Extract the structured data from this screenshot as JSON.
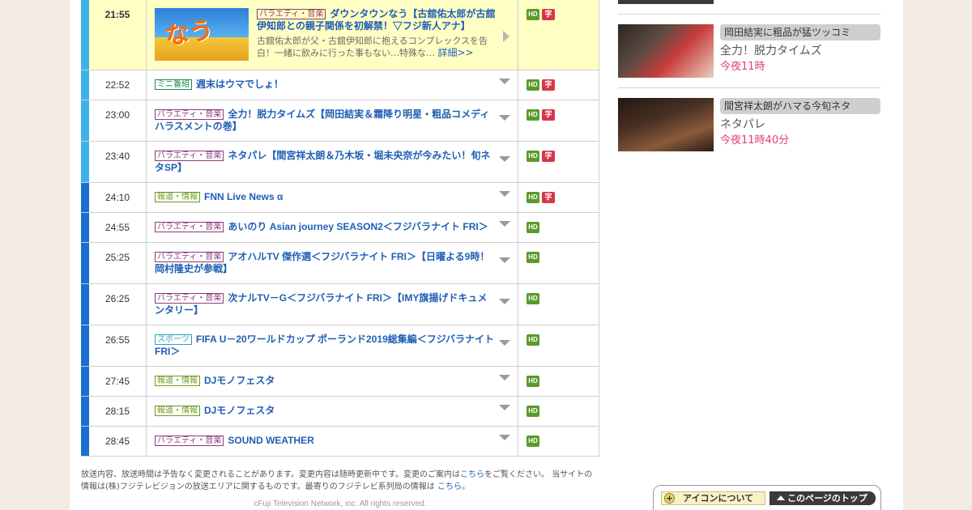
{
  "featured": {
    "time": "21:55",
    "genre": "バラエティ・音楽",
    "title": "ダウンタウンなう【古舘佑太郎が古舘伊知郎との親子関係を初解禁！▽フジ新人アナ】",
    "description": "古舘佑太郎が父・古舘伊知郎に抱えるコンプレックスを告白！一緒に飲みに行った事もない…特殊な…",
    "more_link": "詳細>>",
    "thumb_logo": "なう",
    "hd": "HD",
    "caption": "字"
  },
  "programs": [
    {
      "time": "22:52",
      "genre": "ミニ番組",
      "genre_type": "mini",
      "title": "週末はウマでしょ！",
      "hd": "HD",
      "caption": "字"
    },
    {
      "time": "23:00",
      "genre": "バラエティ・音楽",
      "genre_type": "var",
      "title": "全力！脱力タイムズ【岡田結実＆霜降り明星・粗品コメディハラスメントの巻】",
      "hd": "HD",
      "caption": "字"
    },
    {
      "time": "23:40",
      "genre": "バラエティ・音楽",
      "genre_type": "var",
      "title": "ネタパレ【間宮祥太朗＆乃木坂・堀未央奈が今みたい！旬ネタSP】",
      "hd": "HD",
      "caption": "字"
    },
    {
      "time": "24:10",
      "genre": "報道・情報",
      "genre_type": "news",
      "title": "FNN Live News α",
      "hd": "HD",
      "caption": "字"
    },
    {
      "time": "24:55",
      "genre": "バラエティ・音楽",
      "genre_type": "var",
      "title": "あいのり Asian journey SEASON2＜フジバラナイト FRI＞",
      "hd": "HD",
      "caption": ""
    },
    {
      "time": "25:25",
      "genre": "バラエティ・音楽",
      "genre_type": "var",
      "title": "アオハルTV 傑作選＜フジバラナイト FRI＞【日曜よる9時！岡村隆史が参戦】",
      "hd": "HD",
      "caption": ""
    },
    {
      "time": "26:25",
      "genre": "バラエティ・音楽",
      "genre_type": "var",
      "title": "次ナルTV－G＜フジバラナイト FRI＞【IMY旗揚げドキュメンタリー】",
      "hd": "HD",
      "caption": ""
    },
    {
      "time": "26:55",
      "genre": "スポーツ",
      "genre_type": "sport",
      "title": "FIFA U－20ワールドカップ ポーランド2019総集編＜フジバラナイト FRI＞",
      "hd": "HD",
      "caption": ""
    },
    {
      "time": "27:45",
      "genre": "報道・情報",
      "genre_type": "news",
      "title": "DJモノフェスタ",
      "hd": "HD",
      "caption": ""
    },
    {
      "time": "28:15",
      "genre": "報道・情報",
      "genre_type": "news",
      "title": "DJモノフェスタ",
      "hd": "HD",
      "caption": ""
    },
    {
      "time": "28:45",
      "genre": "バラエティ・音楽",
      "genre_type": "var",
      "title": "SOUND WEATHER",
      "hd": "HD",
      "caption": ""
    }
  ],
  "notes": {
    "line1_a": "放送内容、放送時間は予告なく変更されることがあります。変更内容は随時更新中です。変更のご案内は",
    "link1": "こちら",
    "line1_b": "をご覧ください。 当サイトの",
    "line2_a": "情報は(株)フジテレビジョンの放送エリアに関するものです。最寄りのフジテレビ系列局の情報は ",
    "link2": "こちら",
    "line2_b": "。",
    "copyright": "cFuji Television Network, inc. All rights reserved."
  },
  "sidebar": {
    "items": [
      {
        "tag": "岡田結実に粗品が猛ツッコミ",
        "name": "全力！脱力タイムズ",
        "when": "今夜11時"
      },
      {
        "tag": "間宮祥太朗がハマる今旬ネタ",
        "name": "ネタパレ",
        "when": "今夜11時40分"
      }
    ]
  },
  "buttons": {
    "icon_help": "アイコンについて",
    "page_top": "このページのトップ"
  },
  "colors": {
    "bar_light": "#3eb1e8",
    "bar_dark": "#1a6fd0",
    "link_blue": "#1f5fb4",
    "current_row": "#ffffc4",
    "accent_pink": "#e03c7a"
  }
}
